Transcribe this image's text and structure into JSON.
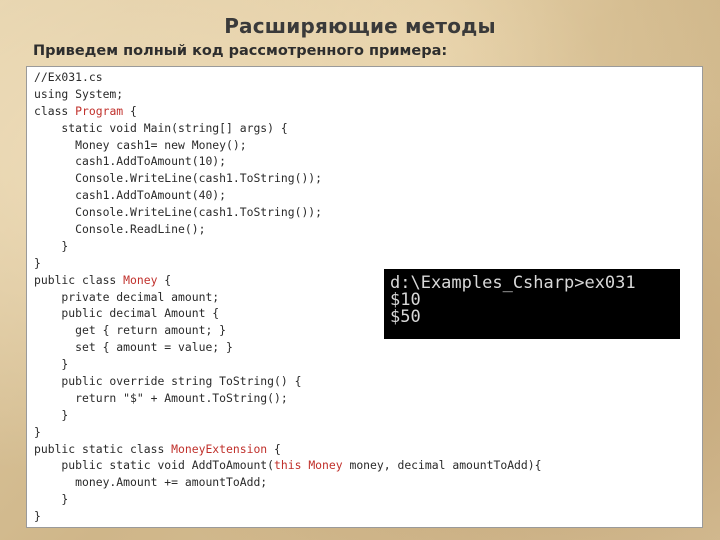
{
  "slide": {
    "title": "Расширяющие методы",
    "subtitle": "Приведем полный код рассмотренного примера:"
  },
  "code": {
    "lines": [
      [
        {
          "t": "//Ex031.cs"
        }
      ],
      [
        {
          "t": "using System;"
        }
      ],
      [
        {
          "t": "class "
        },
        {
          "t": "Program",
          "k": true
        },
        {
          "t": " {"
        }
      ],
      [
        {
          "t": "    static void Main(string[] args) {"
        }
      ],
      [
        {
          "t": "      Money cash1= new Money();"
        }
      ],
      [
        {
          "t": "      cash1.AddToAmount(10);"
        }
      ],
      [
        {
          "t": "      Console.WriteLine(cash1.ToString());"
        }
      ],
      [
        {
          "t": "      cash1.AddToAmount(40);"
        }
      ],
      [
        {
          "t": "      Console.WriteLine(cash1.ToString());"
        }
      ],
      [
        {
          "t": "      Console.ReadLine();"
        }
      ],
      [
        {
          "t": "    }"
        }
      ],
      [
        {
          "t": "}"
        }
      ],
      [
        {
          "t": "public class "
        },
        {
          "t": "Money",
          "k": true
        },
        {
          "t": " {"
        }
      ],
      [
        {
          "t": "    private decimal amount;"
        }
      ],
      [
        {
          "t": "    public decimal Amount {"
        }
      ],
      [
        {
          "t": "      get { return amount; }"
        }
      ],
      [
        {
          "t": "      set { amount = value; }"
        }
      ],
      [
        {
          "t": "    }"
        }
      ],
      [
        {
          "t": "    public override string ToString() {"
        }
      ],
      [
        {
          "t": "      return \"$\" + Amount.ToString();"
        }
      ],
      [
        {
          "t": "    }"
        }
      ],
      [
        {
          "t": "}"
        }
      ],
      [
        {
          "t": "public static class "
        },
        {
          "t": "MoneyExtension",
          "k": true
        },
        {
          "t": " {"
        }
      ],
      [
        {
          "t": "    public static void AddToAmount("
        },
        {
          "t": "this Money",
          "k": true
        },
        {
          "t": " money, decimal amountToAdd){"
        }
      ],
      [
        {
          "t": "      money.Amount += amountToAdd;"
        }
      ],
      [
        {
          "t": "    }"
        }
      ],
      [
        {
          "t": "}"
        }
      ]
    ],
    "keyword_color": "#c0302b"
  },
  "console": {
    "lines": [
      "d:\\Examples_Csharp>ex031",
      "$10",
      "$50"
    ]
  }
}
